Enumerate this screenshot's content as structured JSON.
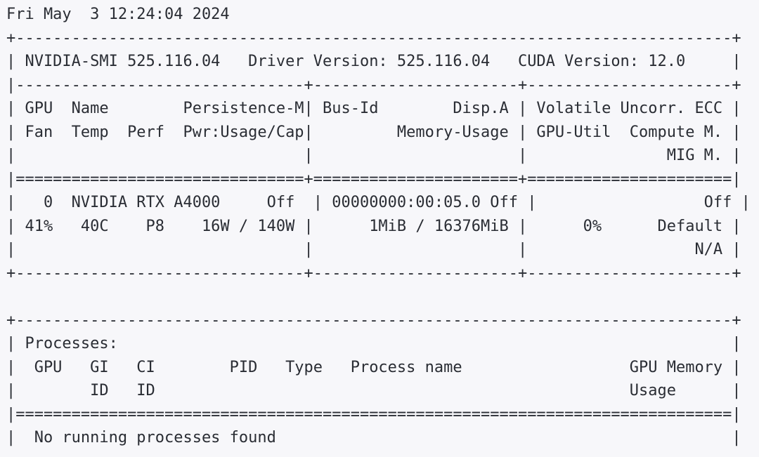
{
  "terminal": {
    "command": "nvidia-smi",
    "background_color": "#f7f7fa",
    "text_color": "#2a2d34",
    "columns": 80,
    "timestamp": "Fri May  3 12:24:04 2024"
  },
  "header": {
    "smi_label": "NVIDIA-SMI",
    "smi_version": "525.116.04",
    "driver_label": "Driver Version:",
    "driver_version": "525.116.04",
    "cuda_label": "CUDA Version:",
    "cuda_version": "12.0"
  },
  "gpu_table": {
    "column_headers_row1": [
      "GPU",
      "Name",
      "Persistence-M",
      "Bus-Id",
      "Disp.A",
      "Volatile Uncorr. ECC"
    ],
    "column_headers_row2": [
      "Fan",
      "Temp",
      "Perf",
      "Pwr:Usage/Cap",
      "Memory-Usage",
      "GPU-Util",
      "Compute M."
    ],
    "column_headers_row3": [
      "MIG M."
    ],
    "rows": [
      {
        "gpu_index": "0",
        "name": "NVIDIA RTX A4000",
        "persistence_m": "Off",
        "bus_id": "00000000:00:05.0",
        "disp_a": "Off",
        "ecc": "Off",
        "fan": "41%",
        "temp": "40C",
        "perf": "P8",
        "pwr_usage_cap": "16W / 140W",
        "memory_usage": "1MiB / 16376MiB",
        "gpu_util": "0%",
        "compute_m": "Default",
        "mig_m": "N/A"
      }
    ]
  },
  "processes_table": {
    "title": "Processes:",
    "column_headers_row1": [
      "GPU",
      "GI",
      "CI",
      "PID",
      "Type",
      "Process name",
      "GPU Memory"
    ],
    "column_headers_row2": [
      "ID",
      "ID",
      "Usage"
    ],
    "empty_message": "No running processes found",
    "rows": []
  },
  "lines": [
    "Fri May  3 12:24:04 2024",
    "+-----------------------------------------------------------------------------+",
    "| NVIDIA-SMI 525.116.04   Driver Version: 525.116.04   CUDA Version: 12.0     |",
    "|-------------------------------+----------------------+----------------------+",
    "| GPU  Name        Persistence-M| Bus-Id        Disp.A | Volatile Uncorr. ECC |",
    "| Fan  Temp  Perf  Pwr:Usage/Cap|         Memory-Usage | GPU-Util  Compute M. |",
    "|                               |                      |               MIG M. |",
    "|===============================+======================+======================|",
    "|   0  NVIDIA RTX A4000     Off  | 00000000:00:05.0 Off |                  Off |",
    "| 41%   40C    P8    16W / 140W |      1MiB / 16376MiB |      0%      Default |",
    "|                               |                      |                  N/A |",
    "+-------------------------------+----------------------+----------------------+",
    "",
    "+-----------------------------------------------------------------------------+",
    "| Processes:                                                                  |",
    "|  GPU   GI   CI        PID   Type   Process name                  GPU Memory |",
    "|        ID   ID                                                   Usage      |",
    "|=============================================================================|",
    "|  No running processes found                                                 |"
  ]
}
